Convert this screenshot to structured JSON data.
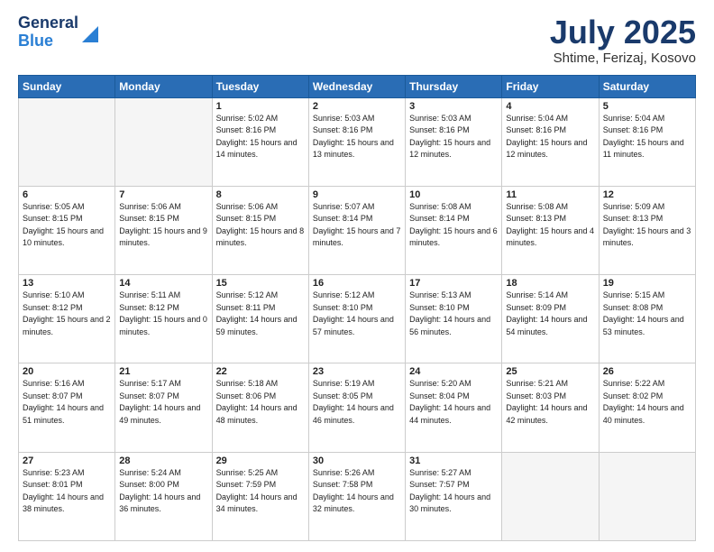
{
  "header": {
    "logo_general": "General",
    "logo_blue": "Blue",
    "month": "July 2025",
    "location": "Shtime, Ferizaj, Kosovo"
  },
  "weekdays": [
    "Sunday",
    "Monday",
    "Tuesday",
    "Wednesday",
    "Thursday",
    "Friday",
    "Saturday"
  ],
  "weeks": [
    [
      {
        "day": "",
        "sunrise": "",
        "sunset": "",
        "daylight": "",
        "empty": true
      },
      {
        "day": "",
        "sunrise": "",
        "sunset": "",
        "daylight": "",
        "empty": true
      },
      {
        "day": "1",
        "sunrise": "Sunrise: 5:02 AM",
        "sunset": "Sunset: 8:16 PM",
        "daylight": "Daylight: 15 hours and 14 minutes.",
        "empty": false
      },
      {
        "day": "2",
        "sunrise": "Sunrise: 5:03 AM",
        "sunset": "Sunset: 8:16 PM",
        "daylight": "Daylight: 15 hours and 13 minutes.",
        "empty": false
      },
      {
        "day": "3",
        "sunrise": "Sunrise: 5:03 AM",
        "sunset": "Sunset: 8:16 PM",
        "daylight": "Daylight: 15 hours and 12 minutes.",
        "empty": false
      },
      {
        "day": "4",
        "sunrise": "Sunrise: 5:04 AM",
        "sunset": "Sunset: 8:16 PM",
        "daylight": "Daylight: 15 hours and 12 minutes.",
        "empty": false
      },
      {
        "day": "5",
        "sunrise": "Sunrise: 5:04 AM",
        "sunset": "Sunset: 8:16 PM",
        "daylight": "Daylight: 15 hours and 11 minutes.",
        "empty": false
      }
    ],
    [
      {
        "day": "6",
        "sunrise": "Sunrise: 5:05 AM",
        "sunset": "Sunset: 8:15 PM",
        "daylight": "Daylight: 15 hours and 10 minutes.",
        "empty": false
      },
      {
        "day": "7",
        "sunrise": "Sunrise: 5:06 AM",
        "sunset": "Sunset: 8:15 PM",
        "daylight": "Daylight: 15 hours and 9 minutes.",
        "empty": false
      },
      {
        "day": "8",
        "sunrise": "Sunrise: 5:06 AM",
        "sunset": "Sunset: 8:15 PM",
        "daylight": "Daylight: 15 hours and 8 minutes.",
        "empty": false
      },
      {
        "day": "9",
        "sunrise": "Sunrise: 5:07 AM",
        "sunset": "Sunset: 8:14 PM",
        "daylight": "Daylight: 15 hours and 7 minutes.",
        "empty": false
      },
      {
        "day": "10",
        "sunrise": "Sunrise: 5:08 AM",
        "sunset": "Sunset: 8:14 PM",
        "daylight": "Daylight: 15 hours and 6 minutes.",
        "empty": false
      },
      {
        "day": "11",
        "sunrise": "Sunrise: 5:08 AM",
        "sunset": "Sunset: 8:13 PM",
        "daylight": "Daylight: 15 hours and 4 minutes.",
        "empty": false
      },
      {
        "day": "12",
        "sunrise": "Sunrise: 5:09 AM",
        "sunset": "Sunset: 8:13 PM",
        "daylight": "Daylight: 15 hours and 3 minutes.",
        "empty": false
      }
    ],
    [
      {
        "day": "13",
        "sunrise": "Sunrise: 5:10 AM",
        "sunset": "Sunset: 8:12 PM",
        "daylight": "Daylight: 15 hours and 2 minutes.",
        "empty": false
      },
      {
        "day": "14",
        "sunrise": "Sunrise: 5:11 AM",
        "sunset": "Sunset: 8:12 PM",
        "daylight": "Daylight: 15 hours and 0 minutes.",
        "empty": false
      },
      {
        "day": "15",
        "sunrise": "Sunrise: 5:12 AM",
        "sunset": "Sunset: 8:11 PM",
        "daylight": "Daylight: 14 hours and 59 minutes.",
        "empty": false
      },
      {
        "day": "16",
        "sunrise": "Sunrise: 5:12 AM",
        "sunset": "Sunset: 8:10 PM",
        "daylight": "Daylight: 14 hours and 57 minutes.",
        "empty": false
      },
      {
        "day": "17",
        "sunrise": "Sunrise: 5:13 AM",
        "sunset": "Sunset: 8:10 PM",
        "daylight": "Daylight: 14 hours and 56 minutes.",
        "empty": false
      },
      {
        "day": "18",
        "sunrise": "Sunrise: 5:14 AM",
        "sunset": "Sunset: 8:09 PM",
        "daylight": "Daylight: 14 hours and 54 minutes.",
        "empty": false
      },
      {
        "day": "19",
        "sunrise": "Sunrise: 5:15 AM",
        "sunset": "Sunset: 8:08 PM",
        "daylight": "Daylight: 14 hours and 53 minutes.",
        "empty": false
      }
    ],
    [
      {
        "day": "20",
        "sunrise": "Sunrise: 5:16 AM",
        "sunset": "Sunset: 8:07 PM",
        "daylight": "Daylight: 14 hours and 51 minutes.",
        "empty": false
      },
      {
        "day": "21",
        "sunrise": "Sunrise: 5:17 AM",
        "sunset": "Sunset: 8:07 PM",
        "daylight": "Daylight: 14 hours and 49 minutes.",
        "empty": false
      },
      {
        "day": "22",
        "sunrise": "Sunrise: 5:18 AM",
        "sunset": "Sunset: 8:06 PM",
        "daylight": "Daylight: 14 hours and 48 minutes.",
        "empty": false
      },
      {
        "day": "23",
        "sunrise": "Sunrise: 5:19 AM",
        "sunset": "Sunset: 8:05 PM",
        "daylight": "Daylight: 14 hours and 46 minutes.",
        "empty": false
      },
      {
        "day": "24",
        "sunrise": "Sunrise: 5:20 AM",
        "sunset": "Sunset: 8:04 PM",
        "daylight": "Daylight: 14 hours and 44 minutes.",
        "empty": false
      },
      {
        "day": "25",
        "sunrise": "Sunrise: 5:21 AM",
        "sunset": "Sunset: 8:03 PM",
        "daylight": "Daylight: 14 hours and 42 minutes.",
        "empty": false
      },
      {
        "day": "26",
        "sunrise": "Sunrise: 5:22 AM",
        "sunset": "Sunset: 8:02 PM",
        "daylight": "Daylight: 14 hours and 40 minutes.",
        "empty": false
      }
    ],
    [
      {
        "day": "27",
        "sunrise": "Sunrise: 5:23 AM",
        "sunset": "Sunset: 8:01 PM",
        "daylight": "Daylight: 14 hours and 38 minutes.",
        "empty": false
      },
      {
        "day": "28",
        "sunrise": "Sunrise: 5:24 AM",
        "sunset": "Sunset: 8:00 PM",
        "daylight": "Daylight: 14 hours and 36 minutes.",
        "empty": false
      },
      {
        "day": "29",
        "sunrise": "Sunrise: 5:25 AM",
        "sunset": "Sunset: 7:59 PM",
        "daylight": "Daylight: 14 hours and 34 minutes.",
        "empty": false
      },
      {
        "day": "30",
        "sunrise": "Sunrise: 5:26 AM",
        "sunset": "Sunset: 7:58 PM",
        "daylight": "Daylight: 14 hours and 32 minutes.",
        "empty": false
      },
      {
        "day": "31",
        "sunrise": "Sunrise: 5:27 AM",
        "sunset": "Sunset: 7:57 PM",
        "daylight": "Daylight: 14 hours and 30 minutes.",
        "empty": false
      },
      {
        "day": "",
        "sunrise": "",
        "sunset": "",
        "daylight": "",
        "empty": true
      },
      {
        "day": "",
        "sunrise": "",
        "sunset": "",
        "daylight": "",
        "empty": true
      }
    ]
  ]
}
